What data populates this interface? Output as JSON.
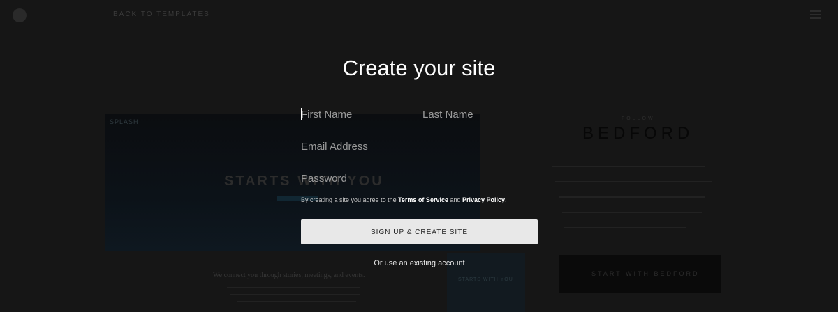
{
  "background": {
    "breadcrumb": "BACK TO TEMPLATES",
    "preview_tag": "SPLASH",
    "preview_headline": "STARTS WITH YOU",
    "preview_caption": "We connect you through stories, meetings, and events.",
    "thumb_text": "STARTS WITH YOU",
    "template_kicker": "FOLLOW",
    "template_name": "BEDFORD",
    "cta_label": "START WITH BEDFORD",
    "logo_icon": "squarespace-logo-icon",
    "menu_icon": "hamburger-menu-icon"
  },
  "modal": {
    "title": "Create your site",
    "first_name_placeholder": "First Name",
    "last_name_placeholder": "Last Name",
    "email_placeholder": "Email Address",
    "password_placeholder": "Password",
    "terms_prefix": "By creating a site you agree to the ",
    "terms_of_service": "Terms of Service",
    "terms_and": " and ",
    "privacy_policy": "Privacy Policy",
    "terms_suffix": ".",
    "signup_button": "SIGN UP & CREATE SITE",
    "existing_account_link": "Or use an existing account"
  },
  "colors": {
    "overlay": "#0f0f0f",
    "button_bg": "#e8e8e8",
    "text": "#ffffff"
  }
}
